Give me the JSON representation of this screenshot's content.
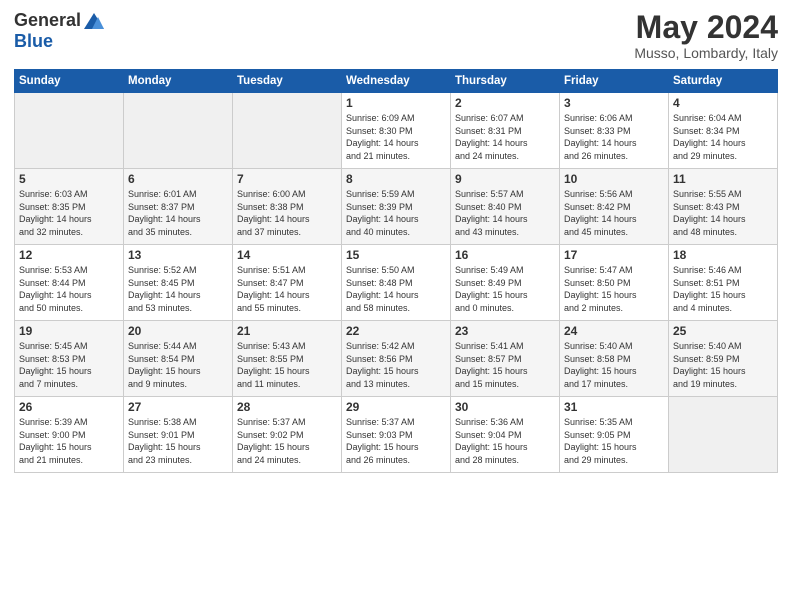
{
  "header": {
    "logo_general": "General",
    "logo_blue": "Blue",
    "month_title": "May 2024",
    "subtitle": "Musso, Lombardy, Italy"
  },
  "days_of_week": [
    "Sunday",
    "Monday",
    "Tuesday",
    "Wednesday",
    "Thursday",
    "Friday",
    "Saturday"
  ],
  "weeks": [
    [
      {
        "num": "",
        "info": ""
      },
      {
        "num": "",
        "info": ""
      },
      {
        "num": "",
        "info": ""
      },
      {
        "num": "1",
        "info": "Sunrise: 6:09 AM\nSunset: 8:30 PM\nDaylight: 14 hours\nand 21 minutes."
      },
      {
        "num": "2",
        "info": "Sunrise: 6:07 AM\nSunset: 8:31 PM\nDaylight: 14 hours\nand 24 minutes."
      },
      {
        "num": "3",
        "info": "Sunrise: 6:06 AM\nSunset: 8:33 PM\nDaylight: 14 hours\nand 26 minutes."
      },
      {
        "num": "4",
        "info": "Sunrise: 6:04 AM\nSunset: 8:34 PM\nDaylight: 14 hours\nand 29 minutes."
      }
    ],
    [
      {
        "num": "5",
        "info": "Sunrise: 6:03 AM\nSunset: 8:35 PM\nDaylight: 14 hours\nand 32 minutes."
      },
      {
        "num": "6",
        "info": "Sunrise: 6:01 AM\nSunset: 8:37 PM\nDaylight: 14 hours\nand 35 minutes."
      },
      {
        "num": "7",
        "info": "Sunrise: 6:00 AM\nSunset: 8:38 PM\nDaylight: 14 hours\nand 37 minutes."
      },
      {
        "num": "8",
        "info": "Sunrise: 5:59 AM\nSunset: 8:39 PM\nDaylight: 14 hours\nand 40 minutes."
      },
      {
        "num": "9",
        "info": "Sunrise: 5:57 AM\nSunset: 8:40 PM\nDaylight: 14 hours\nand 43 minutes."
      },
      {
        "num": "10",
        "info": "Sunrise: 5:56 AM\nSunset: 8:42 PM\nDaylight: 14 hours\nand 45 minutes."
      },
      {
        "num": "11",
        "info": "Sunrise: 5:55 AM\nSunset: 8:43 PM\nDaylight: 14 hours\nand 48 minutes."
      }
    ],
    [
      {
        "num": "12",
        "info": "Sunrise: 5:53 AM\nSunset: 8:44 PM\nDaylight: 14 hours\nand 50 minutes."
      },
      {
        "num": "13",
        "info": "Sunrise: 5:52 AM\nSunset: 8:45 PM\nDaylight: 14 hours\nand 53 minutes."
      },
      {
        "num": "14",
        "info": "Sunrise: 5:51 AM\nSunset: 8:47 PM\nDaylight: 14 hours\nand 55 minutes."
      },
      {
        "num": "15",
        "info": "Sunrise: 5:50 AM\nSunset: 8:48 PM\nDaylight: 14 hours\nand 58 minutes."
      },
      {
        "num": "16",
        "info": "Sunrise: 5:49 AM\nSunset: 8:49 PM\nDaylight: 15 hours\nand 0 minutes."
      },
      {
        "num": "17",
        "info": "Sunrise: 5:47 AM\nSunset: 8:50 PM\nDaylight: 15 hours\nand 2 minutes."
      },
      {
        "num": "18",
        "info": "Sunrise: 5:46 AM\nSunset: 8:51 PM\nDaylight: 15 hours\nand 4 minutes."
      }
    ],
    [
      {
        "num": "19",
        "info": "Sunrise: 5:45 AM\nSunset: 8:53 PM\nDaylight: 15 hours\nand 7 minutes."
      },
      {
        "num": "20",
        "info": "Sunrise: 5:44 AM\nSunset: 8:54 PM\nDaylight: 15 hours\nand 9 minutes."
      },
      {
        "num": "21",
        "info": "Sunrise: 5:43 AM\nSunset: 8:55 PM\nDaylight: 15 hours\nand 11 minutes."
      },
      {
        "num": "22",
        "info": "Sunrise: 5:42 AM\nSunset: 8:56 PM\nDaylight: 15 hours\nand 13 minutes."
      },
      {
        "num": "23",
        "info": "Sunrise: 5:41 AM\nSunset: 8:57 PM\nDaylight: 15 hours\nand 15 minutes."
      },
      {
        "num": "24",
        "info": "Sunrise: 5:40 AM\nSunset: 8:58 PM\nDaylight: 15 hours\nand 17 minutes."
      },
      {
        "num": "25",
        "info": "Sunrise: 5:40 AM\nSunset: 8:59 PM\nDaylight: 15 hours\nand 19 minutes."
      }
    ],
    [
      {
        "num": "26",
        "info": "Sunrise: 5:39 AM\nSunset: 9:00 PM\nDaylight: 15 hours\nand 21 minutes."
      },
      {
        "num": "27",
        "info": "Sunrise: 5:38 AM\nSunset: 9:01 PM\nDaylight: 15 hours\nand 23 minutes."
      },
      {
        "num": "28",
        "info": "Sunrise: 5:37 AM\nSunset: 9:02 PM\nDaylight: 15 hours\nand 24 minutes."
      },
      {
        "num": "29",
        "info": "Sunrise: 5:37 AM\nSunset: 9:03 PM\nDaylight: 15 hours\nand 26 minutes."
      },
      {
        "num": "30",
        "info": "Sunrise: 5:36 AM\nSunset: 9:04 PM\nDaylight: 15 hours\nand 28 minutes."
      },
      {
        "num": "31",
        "info": "Sunrise: 5:35 AM\nSunset: 9:05 PM\nDaylight: 15 hours\nand 29 minutes."
      },
      {
        "num": "",
        "info": ""
      }
    ]
  ]
}
